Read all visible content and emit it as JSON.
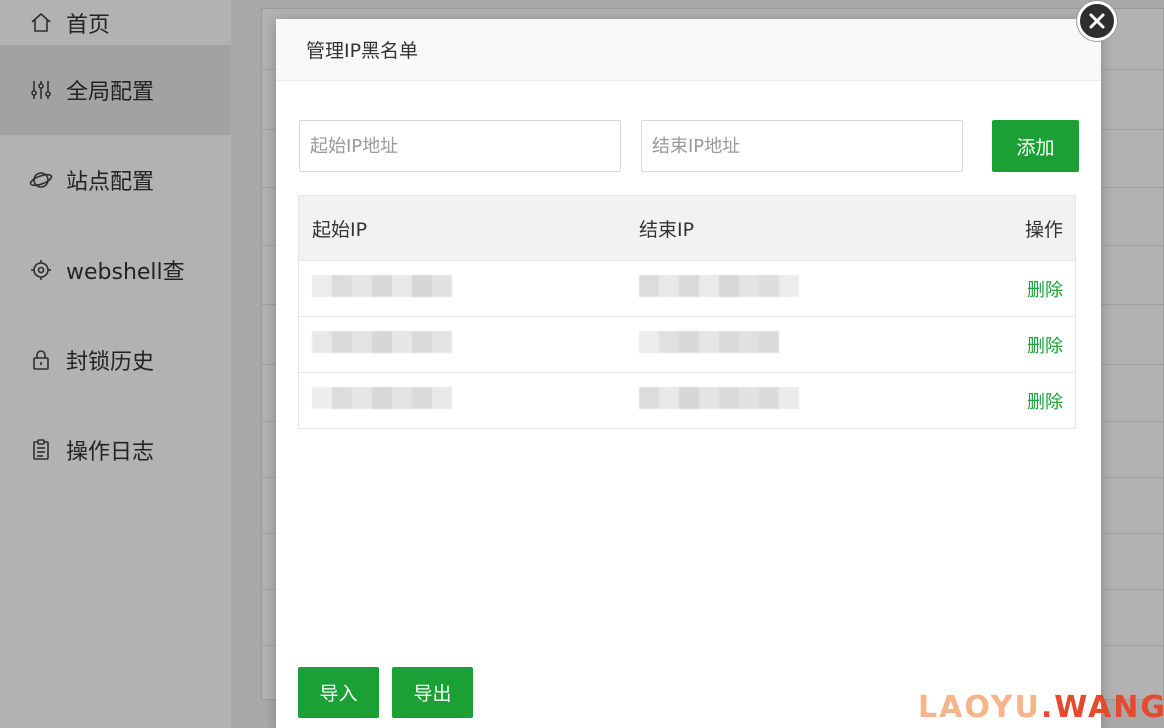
{
  "sidebar": {
    "items": [
      {
        "label": "首页",
        "icon": "home-icon"
      },
      {
        "label": "全局配置",
        "icon": "sliders-icon"
      },
      {
        "label": "站点配置",
        "icon": "planet-icon"
      },
      {
        "label": "webshell查",
        "icon": "target-icon"
      },
      {
        "label": "封锁历史",
        "icon": "lock-history-icon"
      },
      {
        "label": "操作日志",
        "icon": "clipboard-icon"
      }
    ]
  },
  "modal": {
    "title": "管理IP黑名单",
    "start_placeholder": "起始IP地址",
    "end_placeholder": "结束IP地址",
    "add_label": "添加",
    "table": {
      "headers": {
        "start": "起始IP",
        "end": "结束IP",
        "op": "操作"
      },
      "rows": [
        {
          "delete_label": "删除"
        },
        {
          "delete_label": "删除"
        },
        {
          "delete_label": "删除"
        }
      ]
    },
    "import_label": "导入",
    "export_label": "导出"
  },
  "watermark": {
    "part1": "LAOYU",
    "part2": ".WANG"
  },
  "colors": {
    "accent": "#1aa035",
    "overlay": "rgba(0,0,0,0.30)"
  }
}
